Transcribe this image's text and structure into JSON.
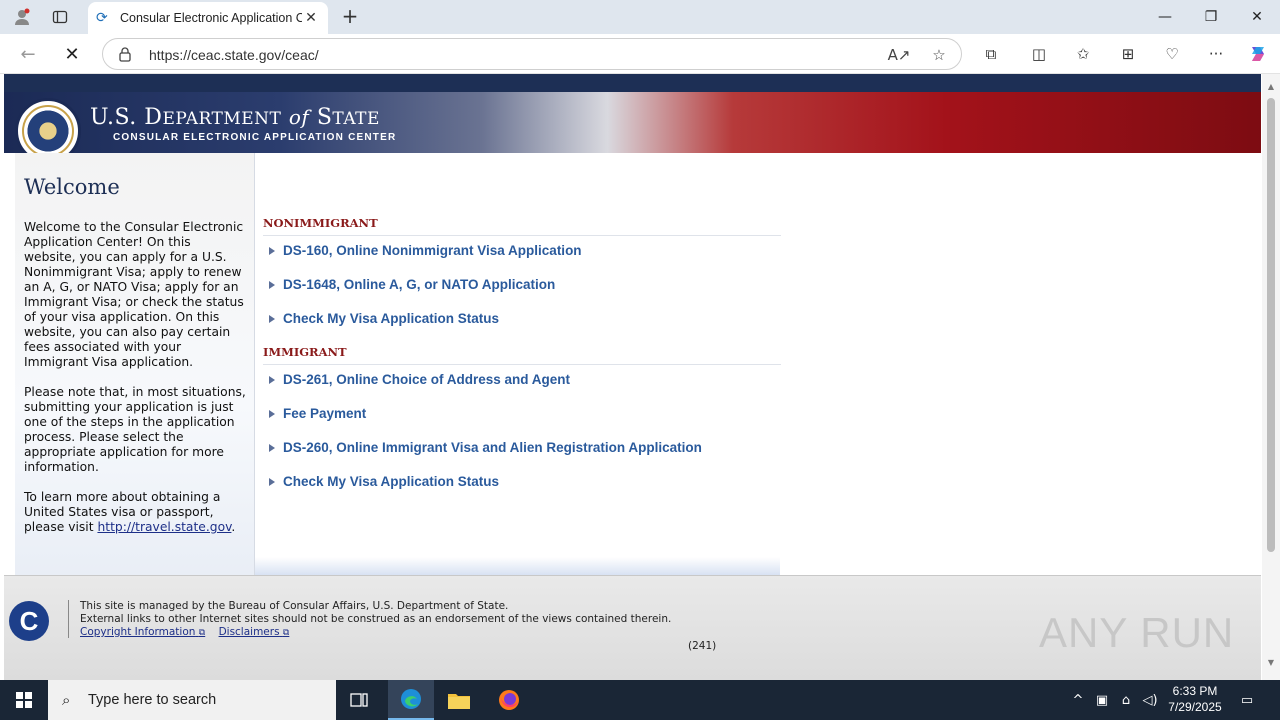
{
  "browser": {
    "tab_title": "Consular Electronic Application Center",
    "url": "https://ceac.state.gov/ceac/",
    "new_tab_symbol": "+",
    "icons": [
      "profile-icon",
      "tab-actions-icon",
      "loading-icon",
      "close-icon",
      "back-icon",
      "stop-icon",
      "lock-icon",
      "read-aloud-icon",
      "favorite-icon",
      "extensions-icon",
      "split-screen-icon",
      "favorites-icon",
      "collections-icon",
      "browser-essentials-icon",
      "more-icon",
      "copilot-icon",
      "minimize-icon",
      "maximize-icon"
    ]
  },
  "banner": {
    "title_us": "U.S. D",
    "title_dept": "EPARTMENT",
    "title_of": "of",
    "title_state_s": "S",
    "title_state": "TATE",
    "subtitle": "CONSULAR ELECTRONIC APPLICATION CENTER"
  },
  "sidebar": {
    "heading": "Welcome",
    "para1": "Welcome to the Consular Electronic Application Center! On this website, you can apply for a U.S. Nonimmigrant Visa; apply to renew an A, G, or NATO Visa; apply for an Immigrant Visa; or check the status of your visa application. On this website, you can also pay certain fees associated with your Immigrant Visa application.",
    "para2": "Please note that, in most situations, submitting your application is just one of the steps in the application process. Please select the appropriate application for more information.",
    "para3_prefix": "To learn more about obtaining a United States visa or passport, please visit ",
    "para3_link": "http://travel.state.gov",
    "para3_suffix": "."
  },
  "nonimmigrant": {
    "heading": "NONIMMIGRANT",
    "links": [
      "DS-160, Online Nonimmigrant Visa Application",
      "DS-1648, Online A, G, or NATO Application",
      "Check My Visa Application Status"
    ]
  },
  "immigrant": {
    "heading": "IMMIGRANT",
    "links": [
      "DS-261, Online Choice of Address and Agent",
      "Fee Payment",
      "DS-260, Online Immigrant Visa and Alien Registration Application",
      "Check My Visa Application Status"
    ]
  },
  "footer": {
    "logo_letter": "C",
    "line1": "This site is managed by the Bureau of Consular Affairs, U.S. Department of State.",
    "line2": "External links to other Internet sites should not be construed as an endorsement of the views contained therein.",
    "copyright_link": "Copyright Information",
    "disclaimers_link": "Disclaimers",
    "count": "(241)",
    "watermark": "ANY RUN"
  },
  "taskbar": {
    "search_placeholder": "Type here to search",
    "time": "6:33 PM",
    "date": "7/29/2025"
  },
  "colors": {
    "navy": "#1d2f55",
    "section_red": "#8a1a1a",
    "link_blue": "#2a5a9c",
    "taskbar": "#1a2636"
  }
}
